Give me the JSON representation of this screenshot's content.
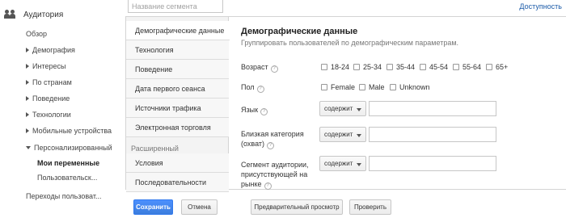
{
  "nav": {
    "title": "Аудитория",
    "items": [
      {
        "label": "Обзор"
      },
      {
        "label": "Демография"
      },
      {
        "label": "Интересы"
      },
      {
        "label": "По странам"
      },
      {
        "label": "Поведение"
      },
      {
        "label": "Технологии"
      },
      {
        "label": "Мобильные устройства"
      },
      {
        "label": "Персонализированный"
      },
      {
        "label": "Мои переменные"
      },
      {
        "label": "Пользовательск..."
      },
      {
        "label": "Переходы пользоват..."
      }
    ]
  },
  "top": {
    "segment_placeholder": "Название сегмента",
    "access_link": "Доступность"
  },
  "tabs": {
    "items": [
      {
        "label": "Демографические данные"
      },
      {
        "label": "Технология"
      },
      {
        "label": "Поведение"
      },
      {
        "label": "Дата первого сеанса"
      },
      {
        "label": "Источники трафика"
      },
      {
        "label": "Электронная торговля"
      }
    ],
    "group_label": "Расширенный",
    "advanced": [
      {
        "label": "Условия"
      },
      {
        "label": "Последовательности"
      }
    ]
  },
  "content": {
    "title": "Демографические данные",
    "description": "Группировать пользователей по демографическим параметрам.",
    "age_label": "Возраст",
    "age_options": [
      "18-24",
      "25-34",
      "35-44",
      "45-54",
      "55-64",
      "65+"
    ],
    "gender_label": "Пол",
    "gender_options": [
      "Female",
      "Male",
      "Unknown"
    ],
    "language_label": "Язык",
    "affinity_label_1": "Близкая категория",
    "affinity_label_2": "(охват)",
    "inmarket_label_1": "Сегмент аудитории,",
    "inmarket_label_2": "присутствующей на",
    "inmarket_label_3": "рынке",
    "contains_label": "содержит",
    "help_glyph": "?"
  },
  "buttons": {
    "save": "Сохранить",
    "cancel": "Отмена",
    "preview": "Предварительный просмотр",
    "check": "Проверить"
  },
  "colors": {
    "accent": "#4d90fe",
    "link": "#1a5aa8"
  }
}
